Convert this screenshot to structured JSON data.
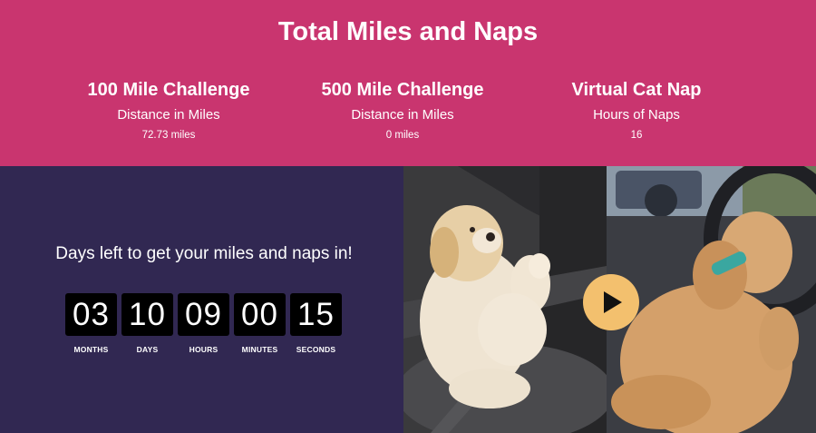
{
  "banner": {
    "title": "Total Miles and Naps",
    "stats": [
      {
        "title": "100 Mile Challenge",
        "subtitle": "Distance in Miles",
        "value": "72.73 miles"
      },
      {
        "title": "500 Mile Challenge",
        "subtitle": "Distance in Miles",
        "value": "0 miles"
      },
      {
        "title": "Virtual Cat Nap",
        "subtitle": "Hours of Naps",
        "value": "16"
      }
    ]
  },
  "countdown": {
    "heading": "Days left to get your miles and naps in!",
    "units": [
      {
        "value": "03",
        "label": "MONTHS"
      },
      {
        "value": "10",
        "label": "DAYS"
      },
      {
        "value": "09",
        "label": "HOURS"
      },
      {
        "value": "00",
        "label": "MINUTES"
      },
      {
        "value": "15",
        "label": "SECONDS"
      }
    ]
  },
  "video": {
    "play_icon": "play-icon"
  },
  "colors": {
    "banner_bg": "#c9356f",
    "panel_bg": "#312852",
    "play_button": "#f3c06e"
  }
}
